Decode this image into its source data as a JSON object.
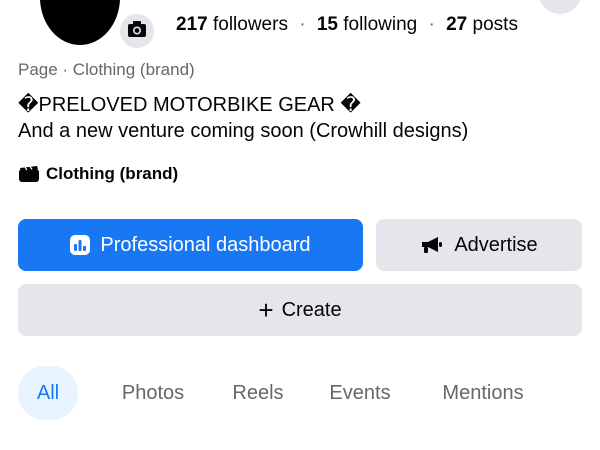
{
  "profile": {
    "stats": {
      "followers_count": "217",
      "followers_label": "followers",
      "following_count": "15",
      "following_label": "following",
      "posts_count": "27",
      "posts_label": "posts",
      "separator": "·"
    },
    "meta": "Page · Clothing (brand)",
    "bio_line1": "�PRELOVED MOTORBIKE GEAR �",
    "bio_line2": "And a new venture coming soon (Crowhill designs)",
    "category": "Clothing (brand)"
  },
  "actions": {
    "professional_dashboard": "Professional dashboard",
    "advertise": "Advertise",
    "create": "Create",
    "create_prefix": "+"
  },
  "tabs": [
    {
      "label": "All",
      "active": true
    },
    {
      "label": "Photos",
      "active": false
    },
    {
      "label": "Reels",
      "active": false
    },
    {
      "label": "Events",
      "active": false
    },
    {
      "label": "Mentions",
      "active": false
    }
  ],
  "colors": {
    "primary": "#1877f2",
    "secondary_bg": "#e4e6eb",
    "active_tab_bg": "#e7f3ff",
    "muted_text": "#65676b"
  },
  "icons": {
    "camera": "camera-icon",
    "dashboard": "dashboard-icon",
    "megaphone": "megaphone-icon",
    "category": "clapperboard-icon"
  }
}
